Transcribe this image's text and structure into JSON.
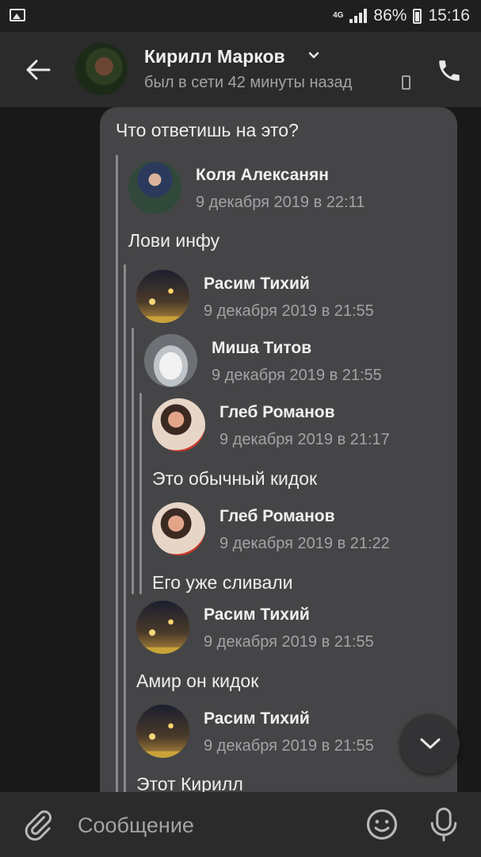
{
  "status_bar": {
    "network": "4G",
    "battery": "86%",
    "time": "15:16"
  },
  "header": {
    "contact_name": "Кирилл Марков",
    "last_seen": "был в сети 42 минуты назад"
  },
  "message": {
    "text": "Что ответишь на это?",
    "forwarded": [
      {
        "author": "Коля Алексанян",
        "date": "9 декабря 2019 в 22:11",
        "text": "Лови инфу"
      },
      {
        "author": "Расим Тихий",
        "date": "9 декабря 2019 в 21:55"
      },
      {
        "author": "Миша Титов",
        "date": "9 декабря 2019 в 21:55"
      },
      {
        "author": "Глеб Романов",
        "date": "9 декабря 2019 в 21:17",
        "text": "Это обычный кидок"
      },
      {
        "author": "Глеб Романов",
        "date": "9 декабря 2019 в 21:22",
        "text": "Его уже сливали"
      },
      {
        "author": "Расим Тихий",
        "date": "9 декабря 2019 в 21:55",
        "text": "Амир он кидок"
      },
      {
        "author": "Расим Тихий",
        "date": "9 декабря 2019 в 21:55",
        "text": "Этот Кирилл"
      }
    ]
  },
  "composer": {
    "placeholder": "Сообщение"
  },
  "colors": {
    "background": "#19191a",
    "header": "#2b2b2c",
    "bubble": "#454547",
    "secondary_text": "#a3a3a6"
  }
}
